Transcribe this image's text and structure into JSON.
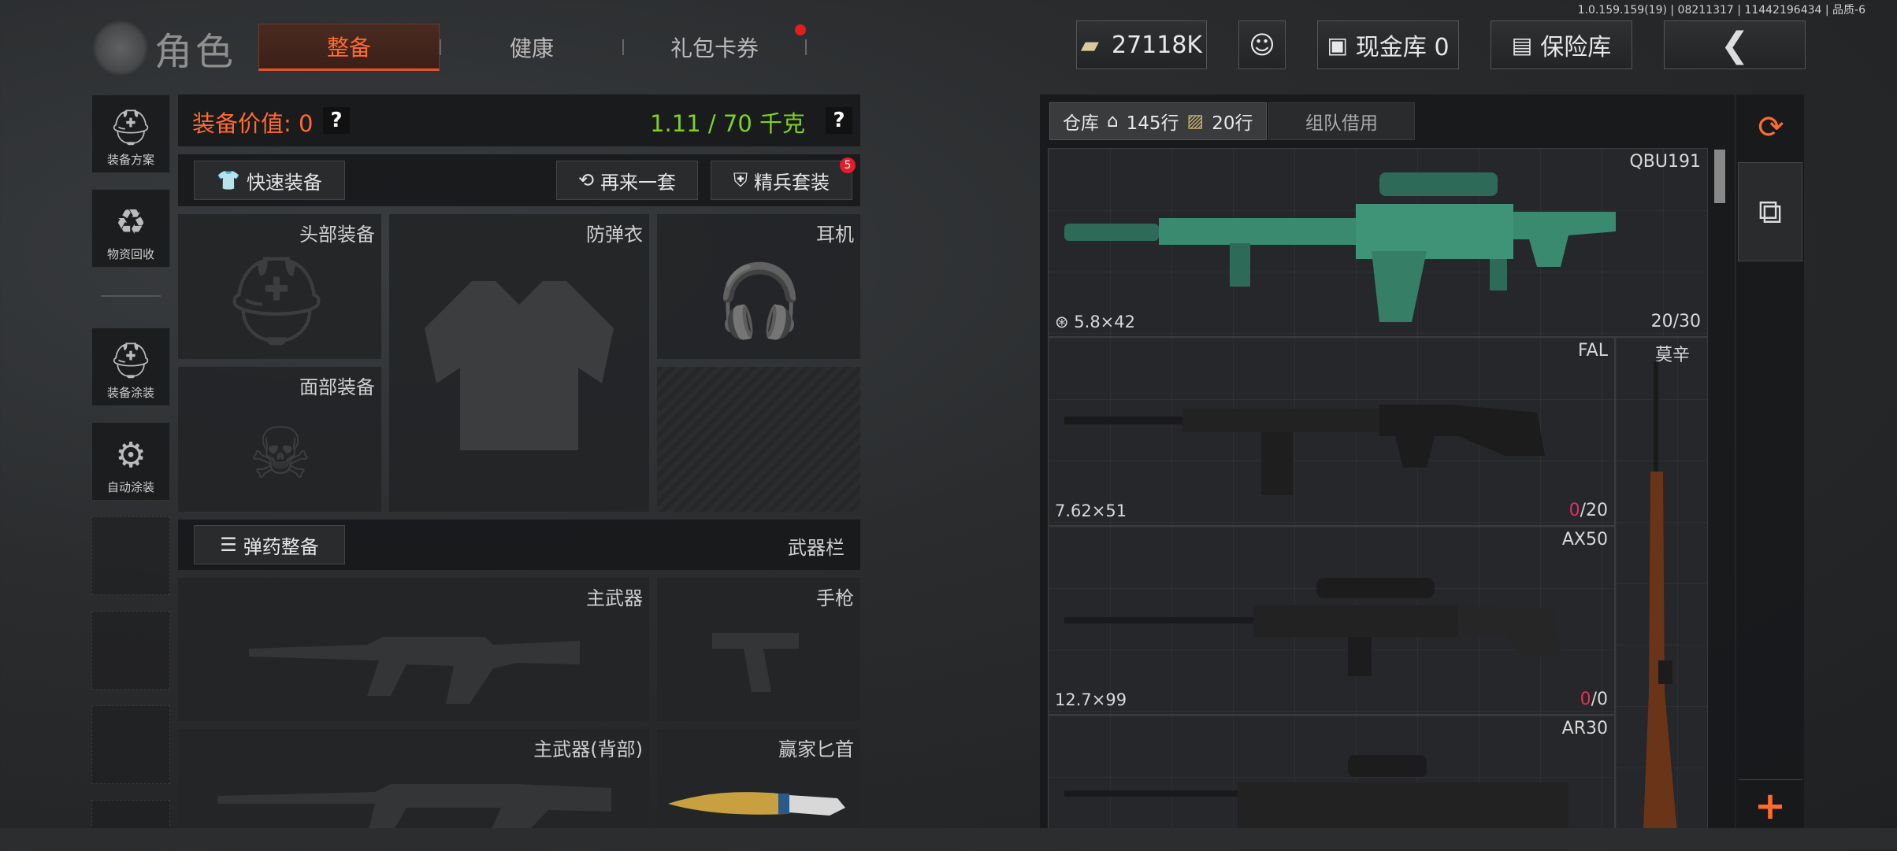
{
  "version": "1.0.159.159(19) | 08211317 | 11442196434 | 品质-6",
  "header": {
    "title": "角色",
    "tabs": [
      "整备",
      "健康",
      "礼包卡券"
    ],
    "currency": "27118K",
    "cash_vault": "现金库 0",
    "safe_box": "保险库"
  },
  "sidebar": {
    "items": [
      "装备方案",
      "物资回收",
      "装备涂装",
      "自动涂装"
    ]
  },
  "equipment": {
    "value_label": "装备价值: 0",
    "weight": "1.11 / 70 千克",
    "quick_equip": "快速装备",
    "again": "再来一套",
    "elite": "精兵套装",
    "elite_badge": "5",
    "slots": {
      "head": "头部装备",
      "armor": "防弹衣",
      "headset": "耳机",
      "face": "面部装备"
    },
    "ammo_btn": "弹药整备",
    "weapon_bar": "武器栏",
    "weapons": {
      "primary": "主武器",
      "pistol": "手枪",
      "primary_back": "主武器(背部)",
      "melee": "赢家匕首"
    }
  },
  "warehouse": {
    "tab": "仓库",
    "rows": "145行",
    "rows2": "20行",
    "team_borrow": "组队借用",
    "items": [
      {
        "name": "QBU191",
        "ammo": "5.8×42",
        "count": "20/30"
      },
      {
        "name": "FAL",
        "ammo": "7.62×51",
        "count_a": "0",
        "count_b": "/20"
      },
      {
        "name": "AX50",
        "ammo": "12.7×99",
        "count_a": "0",
        "count_b": "/0"
      },
      {
        "name": "AR30"
      }
    ],
    "side_item": "莫辛"
  },
  "colors": {
    "accent": "#ff6a2e",
    "weight_green": "#7ed321",
    "alert_red": "#e0305a"
  }
}
